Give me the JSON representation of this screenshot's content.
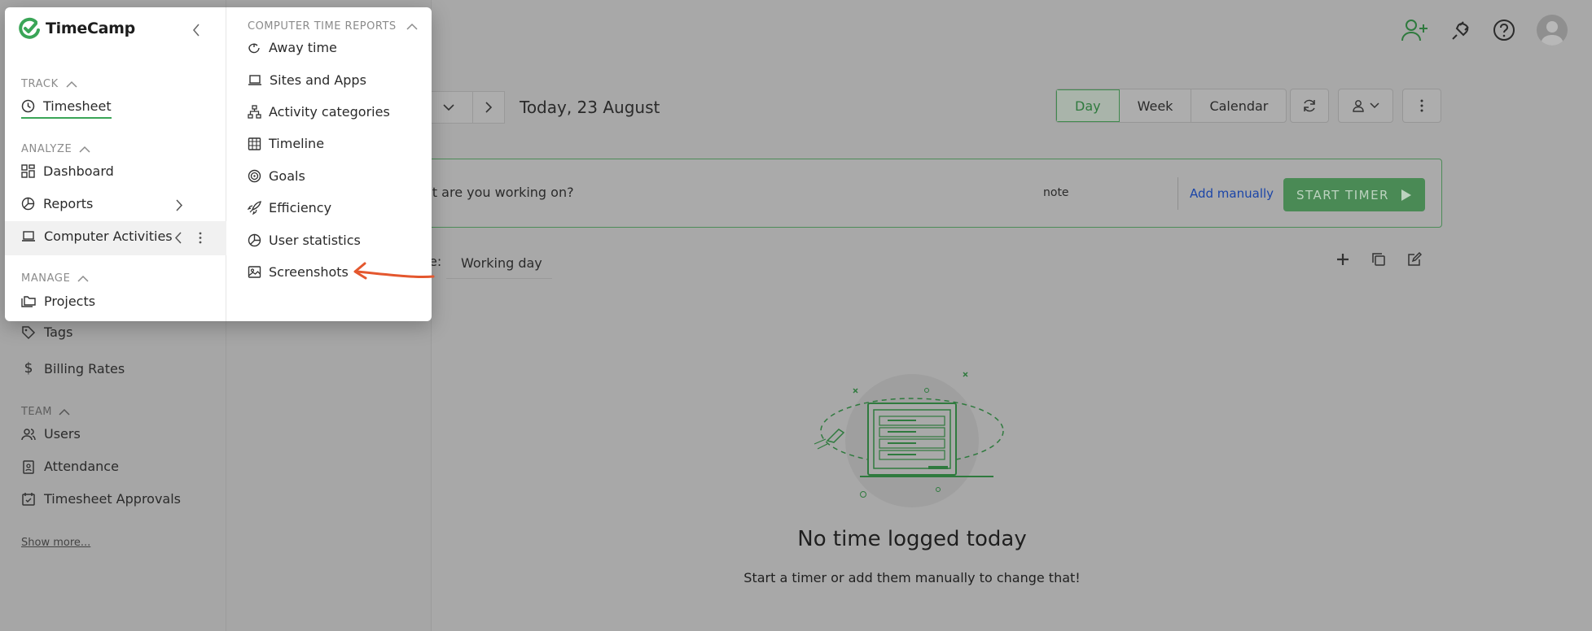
{
  "app": {
    "brand": "TimeCamp"
  },
  "colors": {
    "brand_green": "#3aa557",
    "link_blue": "#1b45a8",
    "annotation_orange": "#e4572e"
  },
  "background": {
    "sidebar_sections": {
      "team": "TEAM"
    },
    "sidebar_items": {
      "tags": "Tags",
      "billing_rates": "Billing Rates",
      "users": "Users",
      "attendance": "Attendance",
      "timesheet_approvals": "Timesheet Approvals"
    },
    "show_more": "Show more...",
    "date_title": "Today, 23 August",
    "views": [
      "Day",
      "Week",
      "Calendar"
    ],
    "timer": {
      "placeholder": "at are you working on?",
      "note": "note",
      "add_manually": "Add manually",
      "start_timer": "START TIMER"
    },
    "working_day_label": "e:",
    "working_day_value": "Working day",
    "empty_title": "No time logged today",
    "empty_subtitle": "Start a timer or add them manually to change that!"
  },
  "menu": {
    "sections": {
      "track": "TRACK",
      "analyze": "ANALYZE",
      "manage": "MANAGE"
    },
    "items": {
      "timesheet": "Timesheet",
      "dashboard": "Dashboard",
      "reports": "Reports",
      "computer_activities": "Computer Activities",
      "projects": "Projects"
    },
    "submenu": {
      "heading": "COMPUTER TIME REPORTS",
      "items": [
        "Away time",
        "Sites and Apps",
        "Activity categories",
        "Timeline",
        "Goals",
        "Efficiency",
        "User statistics",
        "Screenshots"
      ]
    }
  }
}
